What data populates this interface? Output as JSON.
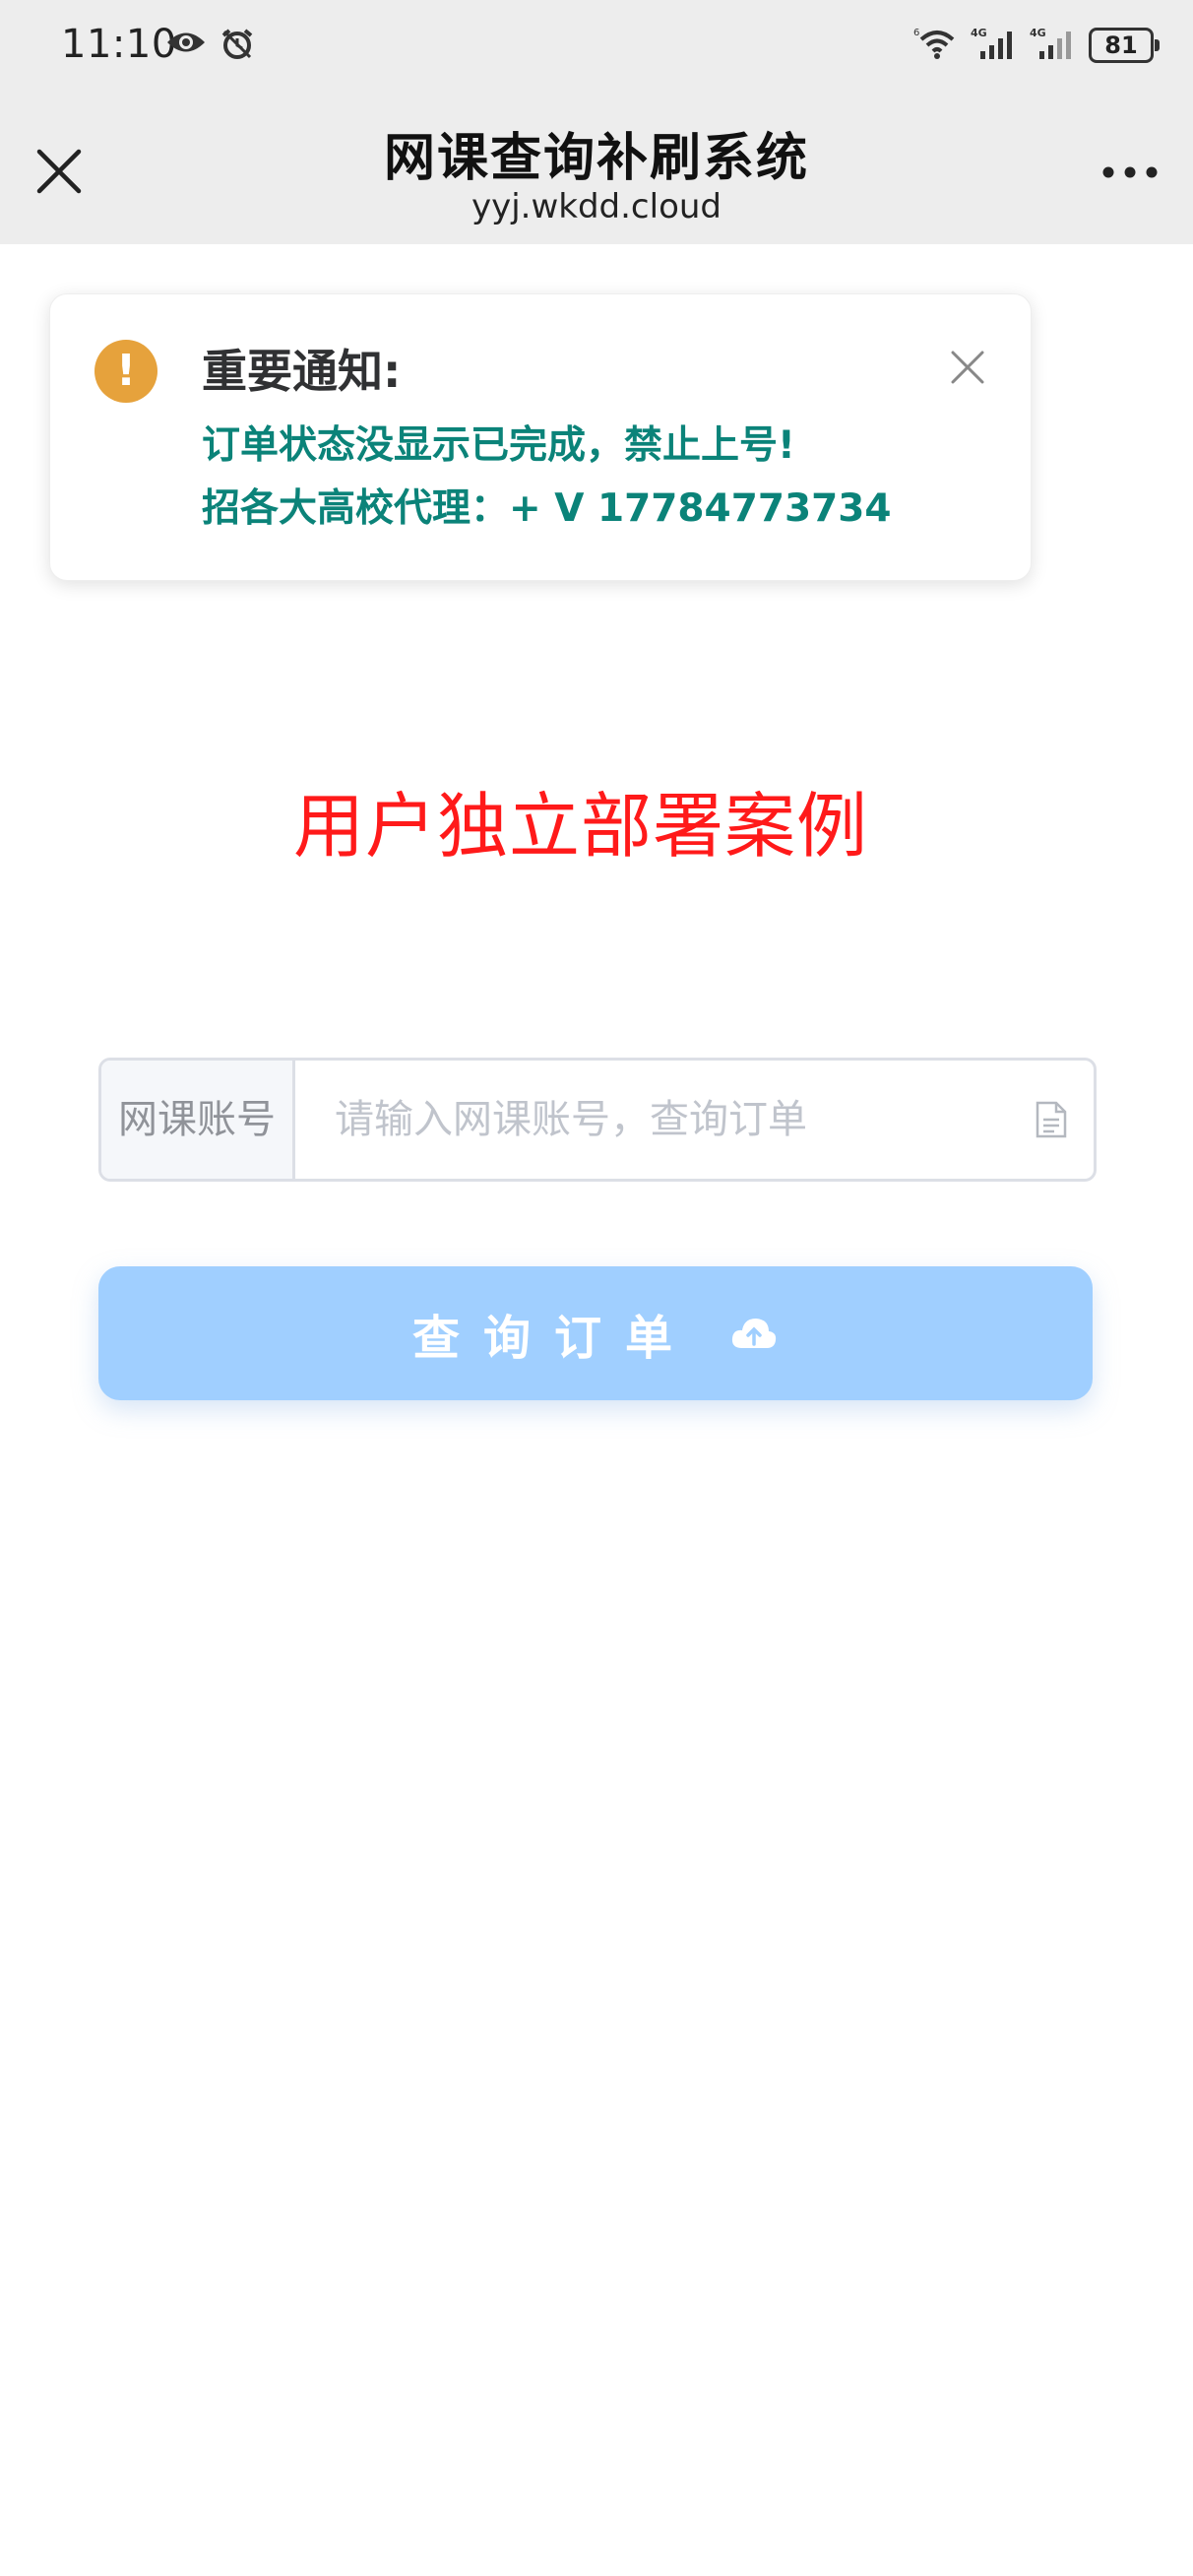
{
  "status_bar": {
    "time": "11:10",
    "network_1": "4G",
    "network_2": "4G",
    "wifi_label": "6",
    "battery": "81"
  },
  "header": {
    "title": "网课查询补刷系统",
    "url": "yyj.wkdd.cloud"
  },
  "notice": {
    "title": "重要通知:",
    "line1": "订单状态没显示已完成，禁止上号!",
    "line2": "招各大高校代理：+ V 17784773734",
    "icon_glyph": "!",
    "icon_color": "#e6a23c",
    "text_color": "#0b8379"
  },
  "headline": {
    "text": "用户独立部署案例",
    "color": "#ff1a1a"
  },
  "query_form": {
    "prepend_label": "网课账号",
    "input_value": "",
    "input_placeholder": "请输入网课账号，查询订单",
    "button_label": "查询订单",
    "button_color": "#a0cfff"
  }
}
